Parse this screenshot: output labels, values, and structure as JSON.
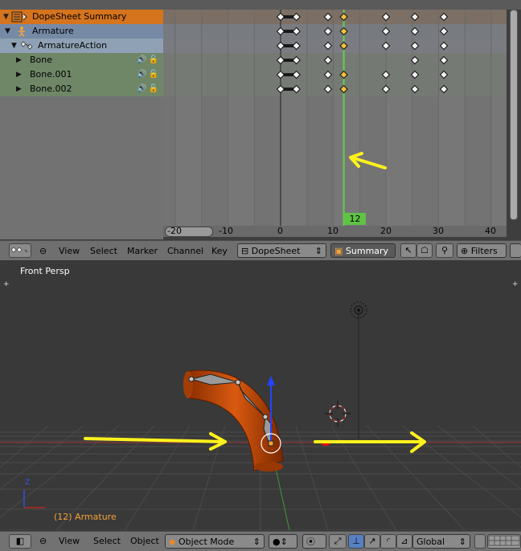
{
  "channels": [
    {
      "label": "DopeSheet Summary",
      "icon": "dopesheet-summary-icon"
    },
    {
      "label": "Armature",
      "icon": "armature-icon"
    },
    {
      "label": "ArmatureAction",
      "icon": "action-icon"
    },
    {
      "label": "Bone"
    },
    {
      "label": "Bone.001"
    },
    {
      "label": "Bone.002"
    }
  ],
  "timeline": {
    "ruler_labels": [
      "-20",
      "-10",
      "0",
      "10",
      "20",
      "30",
      "40"
    ],
    "current_frame": "12",
    "playhead_color": "#63d04a",
    "keyframes_frames": [
      0,
      3,
      9,
      12,
      20,
      25.5,
      31
    ],
    "keyframe_rows": [
      [
        0,
        3,
        9,
        12,
        20,
        25.5,
        31
      ],
      [
        0,
        3,
        9,
        12,
        20,
        25.5,
        31
      ],
      [
        0,
        3,
        9,
        12,
        20,
        25.5,
        31
      ],
      [
        0,
        3,
        9,
        25.5,
        31
      ],
      [
        0,
        3,
        9,
        12,
        20,
        25.5,
        31
      ],
      [
        0,
        3,
        9,
        12,
        20,
        25.5,
        31
      ]
    ]
  },
  "dopesheet_header": {
    "menus": [
      "View",
      "Select",
      "Marker",
      "Channel",
      "Key"
    ],
    "mode": "DopeSheet",
    "summary": "Summary",
    "filters": "Filters"
  },
  "viewport": {
    "view_label": "Front Persp",
    "object_label": "(12) Armature",
    "axis_z": "Z"
  },
  "viewport_header": {
    "menus": [
      "View",
      "Select",
      "Object"
    ],
    "mode": "Object Mode",
    "orientation": "Global"
  },
  "colors": {
    "summary_bg": "#d5741d",
    "armature_bg": "#768aa6",
    "action_bg": "#8fa2b5",
    "bone_bg": "#6f8767",
    "annotation_yellow": "#fff21c",
    "object_orange": "#c74a05"
  }
}
